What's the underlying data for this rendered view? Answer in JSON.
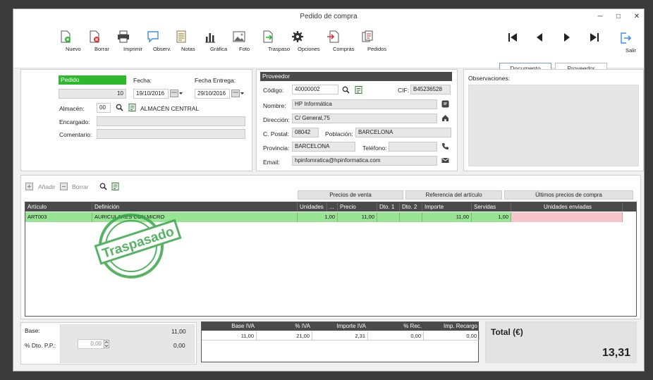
{
  "window": {
    "title": "Pedido de compra"
  },
  "toolbar": {
    "buttons": [
      {
        "label": "Nuevo",
        "icon": "new-doc-icon"
      },
      {
        "label": "Borrar",
        "icon": "delete-doc-icon"
      },
      {
        "label": "Imprimir",
        "icon": "printer-icon"
      },
      {
        "label": "Observ.",
        "icon": "comment-icon"
      },
      {
        "label": "Notas",
        "icon": "notes-icon"
      },
      {
        "label": "Gráfica",
        "icon": "chart-icon"
      },
      {
        "label": "Foto",
        "icon": "photo-icon"
      },
      {
        "label": "Traspaso",
        "icon": "transfer-icon"
      },
      {
        "label": "Opciones",
        "icon": "gear-icon"
      },
      {
        "label": "Compras",
        "icon": "purchases-icon"
      },
      {
        "label": "Pedidos",
        "icon": "orders-icon"
      }
    ],
    "nav": {
      "document_label": "Documento",
      "supplier_label": "Proveedor",
      "exit_label": "Salir"
    }
  },
  "order": {
    "header": "Pedido",
    "number": "10",
    "fecha_label": "Fecha:",
    "fecha": "19/10/2016",
    "fecha_entrega_label": "Fecha Entrega:",
    "fecha_entrega": "29/10/2016",
    "almacen_label": "Almacén:",
    "almacen_code": "00",
    "almacen_name": "ALMACÉN CENTRAL",
    "encargado_label": "Encargado:",
    "comentario_label": "Comentario:"
  },
  "supplier": {
    "header": "Proveedor",
    "codigo_label": "Código:",
    "codigo": "40000002",
    "cif_label": "CIF:",
    "cif": "B45236528",
    "nombre_label": "Nombre:",
    "nombre": "HP Informática",
    "direccion_label": "Dirección:",
    "direccion": "C/ General,75",
    "cpostal_label": "C. Postal:",
    "cpostal": "08042",
    "poblacion_label": "Población:",
    "poblacion": "BARCELONA",
    "provincia_label": "Provincia:",
    "provincia": "BARCELONA",
    "telefono_label": "Teléfono:",
    "telefono": "",
    "email_label": "Email:",
    "email": "hpinfomratica@hpinformatica.com"
  },
  "observaciones": {
    "label": "Observaciones:"
  },
  "lines": {
    "add_label": "Añadir",
    "delete_label": "Borrar",
    "tabs": [
      "Precios de venta",
      "Referencia del artículo",
      "Últimos precios de compra"
    ],
    "columns": [
      "Artículo",
      "Definición",
      "Unidades",
      "...",
      "Precio",
      "Dto. 1",
      "Dto. 2",
      "Importe",
      "Servidas",
      "Unidades enviadas"
    ],
    "rows": [
      {
        "articulo": "ART003",
        "definicion": "AURICULARES CON MICRO",
        "unidades": "1,00",
        "precio": "11,00",
        "dto1": "",
        "dto2": "",
        "importe": "11,00",
        "servidas": "1,00",
        "enviadas": ""
      }
    ],
    "stamp_text": "Traspasado"
  },
  "totals": {
    "base_label": "Base:",
    "base": "11,00",
    "dto_pp_label": "% Dto. P.P.:",
    "dto_pp_input": "0,00",
    "dto_pp_value": "0,00",
    "iva_columns": [
      "Base IVA",
      "% IVA",
      "Importe IVA",
      "% Rec.",
      "Imp. Recargo"
    ],
    "iva_rows": [
      {
        "base": "11,00",
        "pct": "21,00",
        "importe": "2,31",
        "rec": "0,00",
        "recargo": "0,00"
      }
    ],
    "total_label": "Total (€)",
    "total": "13,31"
  }
}
